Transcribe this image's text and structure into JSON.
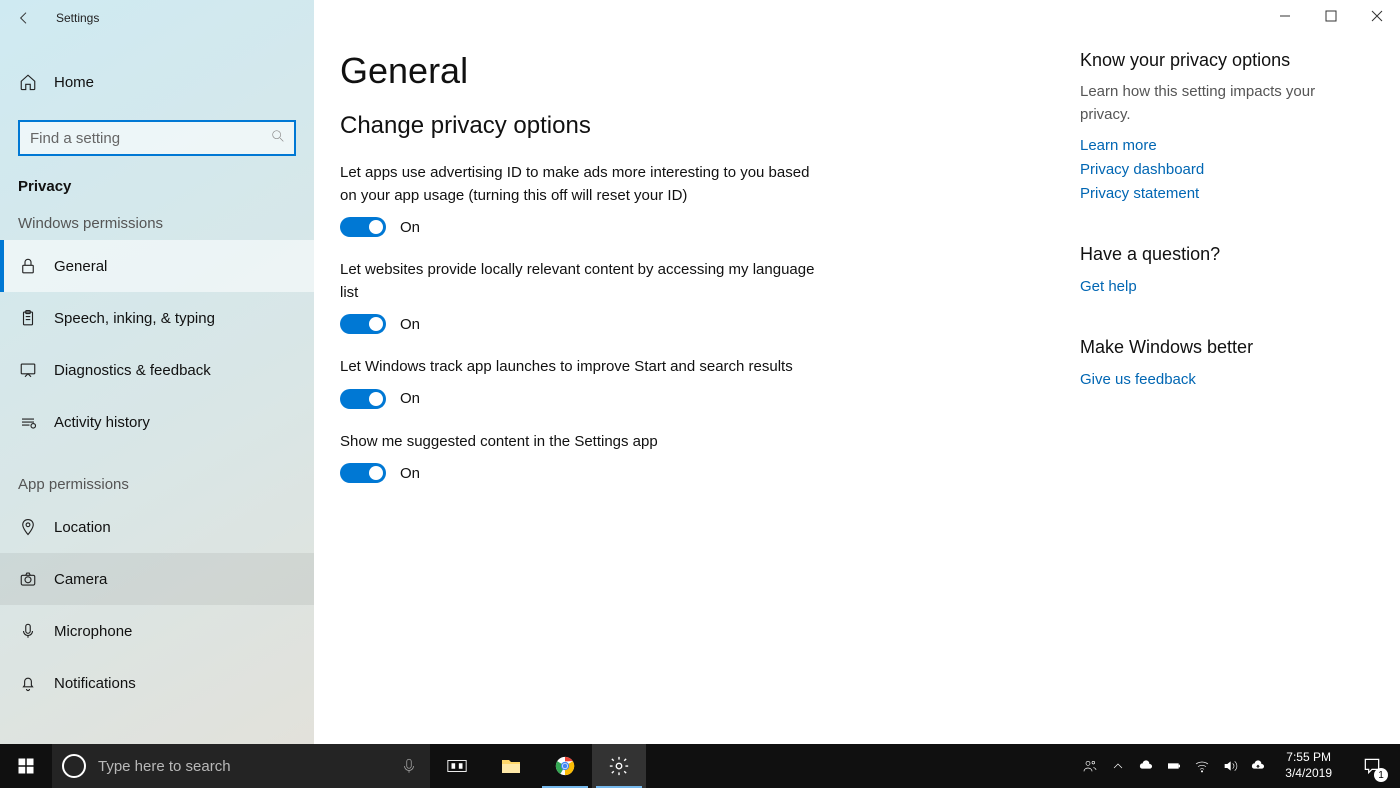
{
  "window": {
    "title": "Settings"
  },
  "sidebar": {
    "home": "Home",
    "search_placeholder": "Find a setting",
    "category": "Privacy",
    "group1_label": "Windows permissions",
    "group1": [
      {
        "label": "General",
        "icon": "lock"
      },
      {
        "label": "Speech, inking, & typing",
        "icon": "clipboard"
      },
      {
        "label": "Diagnostics & feedback",
        "icon": "feedback"
      },
      {
        "label": "Activity history",
        "icon": "history"
      }
    ],
    "group2_label": "App permissions",
    "group2": [
      {
        "label": "Location",
        "icon": "location"
      },
      {
        "label": "Camera",
        "icon": "camera"
      },
      {
        "label": "Microphone",
        "icon": "mic"
      },
      {
        "label": "Notifications",
        "icon": "bell"
      }
    ]
  },
  "main": {
    "h1": "General",
    "h2": "Change privacy options",
    "settings": [
      {
        "label": "Let apps use advertising ID to make ads more interesting to you based on your app usage (turning this off will reset your ID)",
        "state": "On"
      },
      {
        "label": "Let websites provide locally relevant content by accessing my language list",
        "state": "On"
      },
      {
        "label": "Let Windows track app launches to improve Start and search results",
        "state": "On"
      },
      {
        "label": "Show me suggested content in the Settings app",
        "state": "On"
      }
    ]
  },
  "aside": {
    "block1_title": "Know your privacy options",
    "block1_text": "Learn how this setting impacts your privacy.",
    "block1_links": [
      "Learn more",
      "Privacy dashboard",
      "Privacy statement"
    ],
    "block2_title": "Have a question?",
    "block2_link": "Get help",
    "block3_title": "Make Windows better",
    "block3_link": "Give us feedback"
  },
  "taskbar": {
    "search_placeholder": "Type here to search",
    "time": "7:55 PM",
    "date": "3/4/2019",
    "notif_count": "1"
  }
}
